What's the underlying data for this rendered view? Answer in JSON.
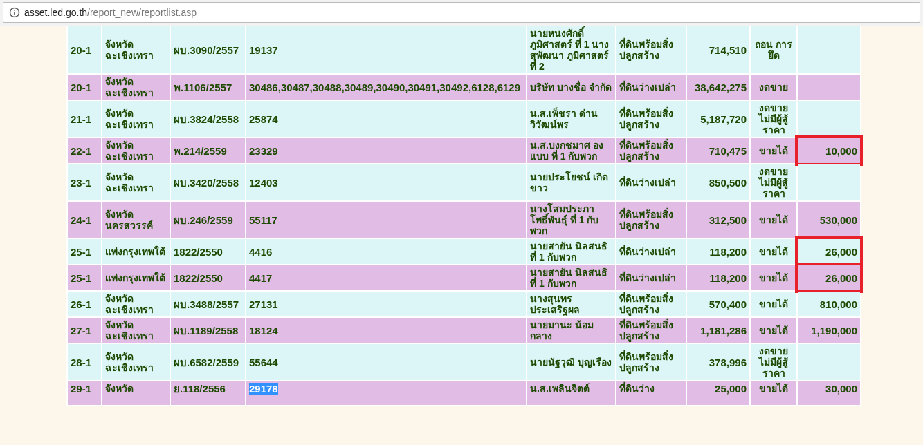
{
  "address_bar": {
    "domain": "asset.led.go.th",
    "path": "/report_new/reportlist.asp"
  },
  "rows": [
    {
      "no": "20-1",
      "court": "จังหวัดฉะเชิงเทรา",
      "case": "ผบ.3090/2557",
      "deed": "19137",
      "deed_selected": false,
      "owner": "นายหนงศักดิ์ ภูมิศาสตร์ ที่ 1 นางสุพัฒนา ภูมิศาสตร์ ที่ 2",
      "type": "ที่ดินพร้อมสิ่งปลูกสร้าง",
      "price": "714,510",
      "status": "ถอน การยึด",
      "sold": "",
      "boxed": false
    },
    {
      "no": "20-1",
      "court": "จังหวัดฉะเชิงเทรา",
      "case": "พ.1106/2557",
      "deed": "30486,30487,30488,30489,30490,30491,30492,6128,6129",
      "deed_selected": false,
      "owner": "บริษัท บางชื่อ จำกัด",
      "type": "ที่ดินว่างเปล่า",
      "price": "38,642,275",
      "status": "งดขาย",
      "sold": "",
      "boxed": false
    },
    {
      "no": "21-1",
      "court": "จังหวัดฉะเชิงเทรา",
      "case": "ผบ.3824/2558",
      "deed": "25874",
      "deed_selected": false,
      "owner": "น.ส.เพ็ชรา ด่าน วิวัฒน์พร",
      "type": "ที่ดินพร้อมสิ่งปลูกสร้าง",
      "price": "5,187,720",
      "status": "งดขาย ไม่มีผู้สู้ราคา",
      "sold": "",
      "boxed": false
    },
    {
      "no": "22-1",
      "court": "จังหวัดฉะเชิงเทรา",
      "case": "พ.214/2559",
      "deed": "23329",
      "deed_selected": false,
      "owner": "น.ส.บงกชมาศ องแบบ ที่ 1 กับพวก",
      "type": "ที่ดินพร้อมสิ่งปลูกสร้าง",
      "price": "710,475",
      "status": "ขายได้",
      "sold": "10,000",
      "boxed": true
    },
    {
      "no": "23-1",
      "court": "จังหวัดฉะเชิงเทรา",
      "case": "ผบ.3420/2558",
      "deed": "12403",
      "deed_selected": false,
      "owner": "นายประโยชน์ เกิดขาว",
      "type": "ที่ดินว่างเปล่า",
      "price": "850,500",
      "status": "งดขาย ไม่มีผู้สู้ราคา",
      "sold": "",
      "boxed": false
    },
    {
      "no": "24-1",
      "court": "จังหวัดนครสวรรค์",
      "case": "ผบ.246/2559",
      "deed": "55117",
      "deed_selected": false,
      "owner": "นางโสมประภา โพธิ์พันธุ์ ที่ 1 กับพวก",
      "type": "ที่ดินพร้อมสิ่งปลูกสร้าง",
      "price": "312,500",
      "status": "ขายได้",
      "sold": "530,000",
      "boxed": false
    },
    {
      "no": "25-1",
      "court": "แพ่งกรุงเทพใต้",
      "case": "1822/2550",
      "deed": "4416",
      "deed_selected": false,
      "owner": "นายสายัน นิลสนธิ ที่ 1 กับพวก",
      "type": "ที่ดินว่างเปล่า",
      "price": "118,200",
      "status": "ขายได้",
      "sold": "26,000",
      "boxed": true
    },
    {
      "no": "25-1",
      "court": "แพ่งกรุงเทพใต้",
      "case": "1822/2550",
      "deed": "4417",
      "deed_selected": false,
      "owner": "นายสายัน นิลสนธิ ที่ 1 กับพวก",
      "type": "ที่ดินว่างเปล่า",
      "price": "118,200",
      "status": "ขายได้",
      "sold": "26,000",
      "boxed": true
    },
    {
      "no": "26-1",
      "court": "จังหวัดฉะเชิงเทรา",
      "case": "ผบ.3488/2557",
      "deed": "27131",
      "deed_selected": false,
      "owner": "นางสุนทร ประเสริฐผล",
      "type": "ที่ดินพร้อมสิ่งปลูกสร้าง",
      "price": "570,400",
      "status": "ขายได้",
      "sold": "810,000",
      "boxed": false
    },
    {
      "no": "27-1",
      "court": "จังหวัดฉะเชิงเทรา",
      "case": "ผบ.1189/2558",
      "deed": "18124",
      "deed_selected": false,
      "owner": "นายมานะ น้อมกลาง",
      "type": "ที่ดินพร้อมสิ่งปลูกสร้าง",
      "price": "1,181,286",
      "status": "ขายได้",
      "sold": "1,190,000",
      "boxed": false
    },
    {
      "no": "28-1",
      "court": "จังหวัดฉะเชิงเทรา",
      "case": "ผบ.6582/2559",
      "deed": "55644",
      "deed_selected": false,
      "owner": "นายนัฐวุฒิ บุญเรือง",
      "type": "ที่ดินพร้อมสิ่งปลูกสร้าง",
      "price": "378,996",
      "status": "งดขาย ไม่มีผู้สู้ราคา",
      "sold": "",
      "boxed": false
    },
    {
      "no": "29-1",
      "court": "จังหวัด",
      "case": "ย.118/2556",
      "deed": "29178",
      "deed_selected": true,
      "owner": "น.ส.เพลินจิตต์",
      "type": "ที่ดินว่าง",
      "price": "25,000",
      "status": "ขายได้",
      "sold": "30,000",
      "boxed": false
    }
  ]
}
